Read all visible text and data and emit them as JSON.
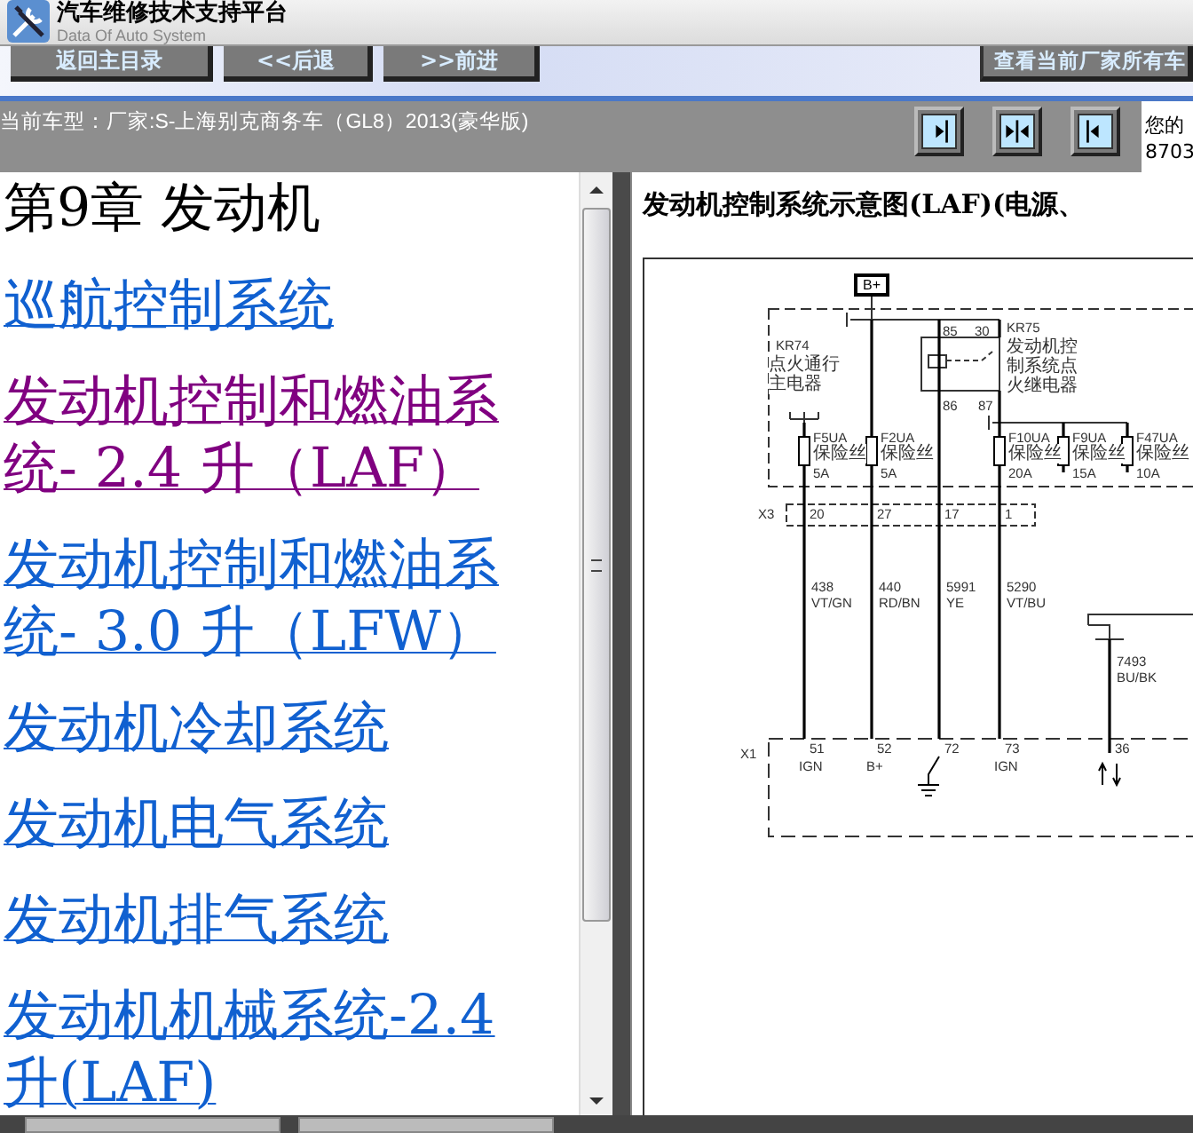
{
  "app": {
    "title": "汽车维修技术支持平台",
    "subtitle": "Data Of Auto System"
  },
  "nav_buttons": [
    "返回主目录",
    "<<后退",
    ">>前进"
  ],
  "right_button": "查看当前厂家所有车",
  "vehicle": "当前车型：厂家:S-上海别克商务车（GL8）2013(豪华版)",
  "view_buttons": [
    {
      "kind": "right"
    },
    {
      "kind": "both"
    },
    {
      "kind": "left"
    }
  ],
  "notice": [
    "您的",
    "8703"
  ],
  "contents": {
    "heading": "第9章 发动机",
    "links": [
      {
        "text": "巡航控制系统",
        "visited": false
      },
      {
        "text": "发动机控制和燃油系统- 2.4 升（LAF）",
        "visited": true
      },
      {
        "text": "发动机控制和燃油系统- 3.0 升（LFW）",
        "visited": false
      },
      {
        "text": "发动机冷却系统",
        "visited": false
      },
      {
        "text": "发动机电气系统",
        "visited": false
      },
      {
        "text": "发动机排气系统",
        "visited": false
      },
      {
        "text": "发动机机械系统-2.4升(LAF)",
        "visited": false
      }
    ]
  },
  "document": {
    "title": "发动机控制系统示意图(LAF)(电源、",
    "diagram": {
      "supply": "B+",
      "relays": [
        {
          "code": "KR74",
          "name": "点火通行主电器"
        },
        {
          "code": "KR75",
          "name": "发动机控制系统点火继电器"
        }
      ],
      "relay_pins": [
        "85",
        "30",
        "86",
        "87"
      ],
      "fuses": [
        {
          "code": "F5UA",
          "name": "保险丝",
          "rating": "5A"
        },
        {
          "code": "F2UA",
          "name": "保险丝",
          "rating": "5A"
        },
        {
          "code": "F10UA",
          "name": "保险丝",
          "rating": "20A"
        },
        {
          "code": "F9UA",
          "name": "保险丝",
          "rating": "15A"
        },
        {
          "code": "F47UA",
          "name": "保险丝",
          "rating": "10A"
        }
      ],
      "connectors": [
        {
          "code": "X3",
          "pins": [
            "20",
            "27",
            "17",
            "1"
          ]
        },
        {
          "code": "X1",
          "pins": [
            "51",
            "52",
            "72",
            "73",
            "36"
          ]
        }
      ],
      "wires": [
        {
          "circuit": "438",
          "insulation": "VT/GN"
        },
        {
          "circuit": "440",
          "insulation": "RD/BN"
        },
        {
          "circuit": "5991",
          "insulation": "YE"
        },
        {
          "circuit": "5290",
          "insulation": "VT/BU"
        },
        {
          "circuit": "7493",
          "insulation": "BU/BK"
        }
      ],
      "terminals": [
        "IGN",
        "B+",
        "IGN"
      ]
    }
  }
}
